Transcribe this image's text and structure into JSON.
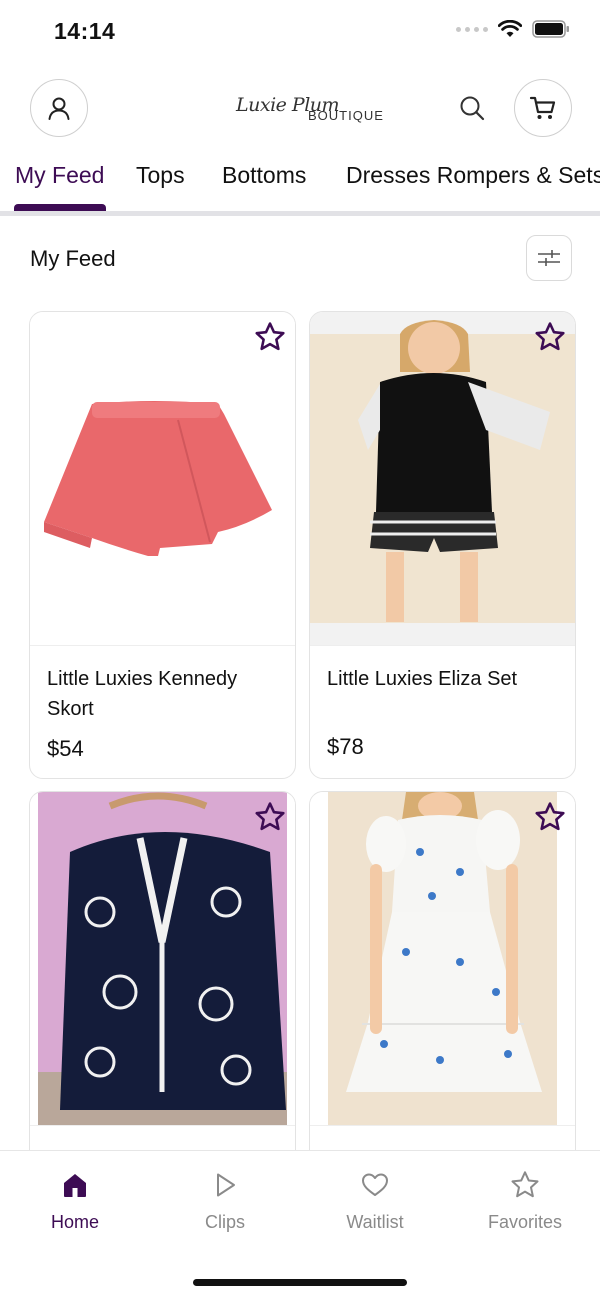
{
  "status_bar": {
    "time": "14:14"
  },
  "header": {
    "logo_script": "Luxie Plum",
    "logo_caps": "BOUTIQUE",
    "icons": [
      "profile-icon",
      "search-icon",
      "cart-icon"
    ]
  },
  "tabs": [
    {
      "label": "My Feed",
      "active": true
    },
    {
      "label": "Tops",
      "active": false
    },
    {
      "label": "Bottoms",
      "active": false
    },
    {
      "label": "Dresses Rompers & Sets",
      "active": false
    }
  ],
  "feed": {
    "title": "My Feed",
    "products": [
      {
        "name": "Little Luxies Kennedy Skort",
        "price": "$54",
        "image": "pink-skort-photo"
      },
      {
        "name": "Little Luxies Eliza Set",
        "price": "$78",
        "image": "black-striped-set-photo"
      },
      {
        "name": "",
        "price": "",
        "image": "navy-floral-outfit-photo"
      },
      {
        "name": "",
        "price": "",
        "image": "white-floral-dress-photo"
      }
    ]
  },
  "bottom_nav": [
    {
      "label": "Home",
      "icon": "home-icon",
      "active": true
    },
    {
      "label": "Clips",
      "icon": "play-icon",
      "active": false
    },
    {
      "label": "Waitlist",
      "icon": "heart-icon",
      "active": false
    },
    {
      "label": "Favorites",
      "icon": "star-icon",
      "active": false
    }
  ],
  "colors": {
    "brand": "#3d0c54",
    "inactive": "#8a8a8a",
    "divider": "#e2e2e6"
  }
}
